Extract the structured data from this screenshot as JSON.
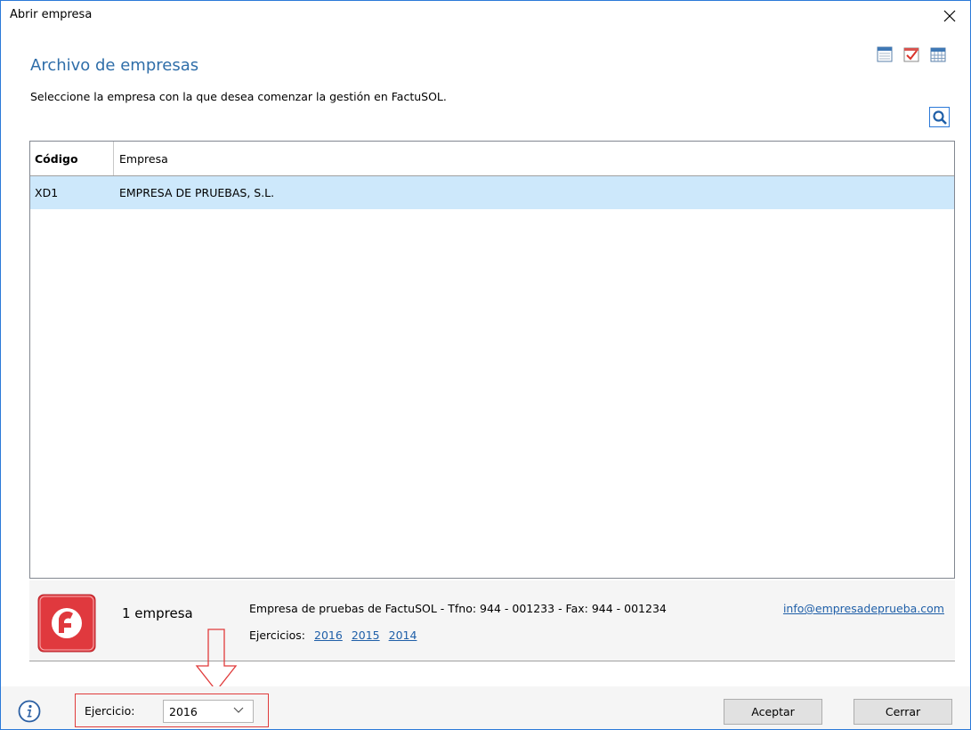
{
  "window": {
    "title": "Abrir empresa",
    "close_symbol": "✕"
  },
  "toolbar": {
    "icons": [
      "calendar-icon",
      "checklist-icon",
      "grid-calendar-icon"
    ]
  },
  "heading": "Archivo de empresas",
  "subtitle": "Seleccione la empresa con la que desea comenzar la gestión en FactuSOL.",
  "search": {
    "icon": "search-icon"
  },
  "table": {
    "columns": [
      "Código",
      "Empresa"
    ],
    "rows": [
      {
        "code": "XD1",
        "name": "EMPRESA DE PRUEBAS, S.L.",
        "selected": true
      }
    ]
  },
  "info_panel": {
    "count": "1 empresa",
    "company_info": "Empresa de pruebas de FactuSOL - Tfno: 944 - 001233 - Fax: 944 - 001234",
    "ejercicios_label": "Ejercicios:",
    "ejercicios": [
      "2016",
      "2015",
      "2014"
    ],
    "email": "info@empresadeprueba.com",
    "logo_color": "#e0393e"
  },
  "footer": {
    "ejercicio_label": "Ejercicio:",
    "ejercicio_value": "2016",
    "accept_label": "Aceptar",
    "close_label": "Cerrar",
    "annotation_color": "#e03b3b"
  }
}
